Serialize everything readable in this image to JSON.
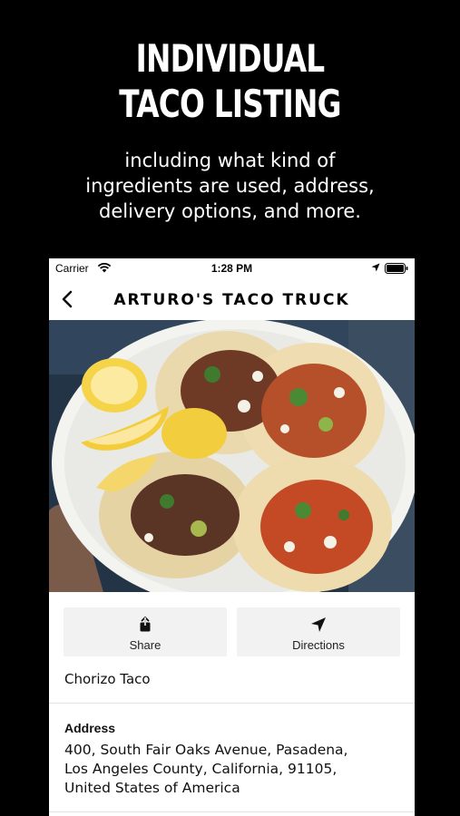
{
  "promo": {
    "title_line1": "INDIVIDUAL",
    "title_line2": "TACO LISTING",
    "subtitle_line1": "including what kind of",
    "subtitle_line2": "ingredients are used, address,",
    "subtitle_line3": "delivery options, and more."
  },
  "status_bar": {
    "carrier": "Carrier",
    "time": "1:28 PM",
    "icons": [
      "wifi-icon",
      "location-arrow-icon",
      "battery-icon"
    ]
  },
  "nav": {
    "title": "ARTURO'S TACO TRUCK",
    "back_icon": "chevron-left-icon"
  },
  "actions": {
    "share_label": "Share",
    "share_icon": "share-icon",
    "directions_label": "Directions",
    "directions_icon": "navigation-arrow-icon"
  },
  "listing": {
    "item_name": "Chorizo Taco",
    "address_label": "Address",
    "address_line1": "400, South Fair Oaks Avenue, Pasadena,",
    "address_line2": "Los Angeles County, California, 91105,",
    "address_line3": "United States of America"
  },
  "colors": {
    "background": "#000000",
    "card": "#ffffff",
    "button_bg": "#f2f2f2",
    "divider": "#e3e3e3"
  }
}
